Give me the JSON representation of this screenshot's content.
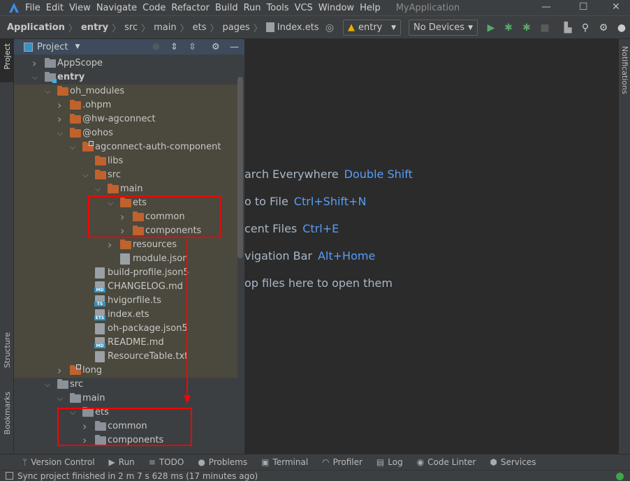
{
  "titlebar": {
    "menus": [
      "File",
      "Edit",
      "View",
      "Navigate",
      "Code",
      "Refactor",
      "Build",
      "Run",
      "Tools",
      "VCS",
      "Window",
      "Help"
    ],
    "app_title": "MyApplication"
  },
  "breadcrumb": [
    "Application",
    "entry",
    "src",
    "main",
    "ets",
    "pages",
    "Index.ets"
  ],
  "toolbar": {
    "module": "entry",
    "device": "No Devices"
  },
  "leftstrip": {
    "project": "Project",
    "structure": "Structure",
    "bookmarks": "Bookmarks"
  },
  "rightstrip": {
    "notifications": "Notifications"
  },
  "panel": {
    "title": "Project"
  },
  "tree": [
    {
      "name": "AppScope",
      "level": 0,
      "kind": "folder",
      "state": "collapsed",
      "color": "gray"
    },
    {
      "name": "entry",
      "level": 0,
      "kind": "module",
      "state": "expanded",
      "color": "gray",
      "bold": true
    },
    {
      "name": "oh_modules",
      "level": 1,
      "kind": "folder",
      "state": "expanded",
      "color": "orange"
    },
    {
      "name": ".ohpm",
      "level": 2,
      "kind": "folder",
      "state": "collapsed",
      "color": "orange"
    },
    {
      "name": "@hw-agconnect",
      "level": 2,
      "kind": "folder",
      "state": "collapsed",
      "color": "orange"
    },
    {
      "name": "@ohos",
      "level": 2,
      "kind": "folder",
      "state": "expanded",
      "color": "orange"
    },
    {
      "name": "agconnect-auth-component",
      "level": 3,
      "kind": "folder",
      "state": "expanded",
      "color": "orange",
      "link": true
    },
    {
      "name": "libs",
      "level": 4,
      "kind": "folder",
      "state": "none",
      "color": "orange"
    },
    {
      "name": "src",
      "level": 4,
      "kind": "folder",
      "state": "expanded",
      "color": "orange"
    },
    {
      "name": "main",
      "level": 5,
      "kind": "folder",
      "state": "expanded",
      "color": "orange"
    },
    {
      "name": "ets",
      "level": 6,
      "kind": "folder",
      "state": "expanded",
      "color": "orange"
    },
    {
      "name": "common",
      "level": 7,
      "kind": "folder",
      "state": "collapsed",
      "color": "orange"
    },
    {
      "name": "components",
      "level": 7,
      "kind": "folder",
      "state": "collapsed",
      "color": "orange"
    },
    {
      "name": "resources",
      "level": 6,
      "kind": "folder",
      "state": "collapsed",
      "color": "orange"
    },
    {
      "name": "module.json",
      "level": 6,
      "kind": "file",
      "tag": "{}"
    },
    {
      "name": "build-profile.json5",
      "level": 4,
      "kind": "file",
      "tag": "{}"
    },
    {
      "name": "CHANGELOG.md",
      "level": 4,
      "kind": "file",
      "tag": "MD"
    },
    {
      "name": "hvigorfile.ts",
      "level": 4,
      "kind": "file",
      "tag": "TS"
    },
    {
      "name": "index.ets",
      "level": 4,
      "kind": "file",
      "tag": "ETS"
    },
    {
      "name": "oh-package.json5",
      "level": 4,
      "kind": "file",
      "tag": "{}"
    },
    {
      "name": "README.md",
      "level": 4,
      "kind": "file",
      "tag": "MD"
    },
    {
      "name": "ResourceTable.txt",
      "level": 4,
      "kind": "file",
      "tag": "TXT"
    },
    {
      "name": "long",
      "level": 2,
      "kind": "folder",
      "state": "collapsed",
      "color": "orange",
      "link": true
    },
    {
      "name": "src",
      "level": 1,
      "kind": "folder",
      "state": "expanded",
      "color": "gray"
    },
    {
      "name": "main",
      "level": 2,
      "kind": "folder",
      "state": "expanded",
      "color": "gray"
    },
    {
      "name": "ets",
      "level": 3,
      "kind": "folder",
      "state": "expanded",
      "color": "gray"
    },
    {
      "name": "common",
      "level": 4,
      "kind": "folder",
      "state": "collapsed",
      "color": "gray"
    },
    {
      "name": "components",
      "level": 4,
      "kind": "folder",
      "state": "collapsed",
      "color": "gray"
    }
  ],
  "editor_hints": [
    {
      "text": "arch Everywhere",
      "key": "Double Shift"
    },
    {
      "text": "o to File",
      "key": "Ctrl+Shift+N"
    },
    {
      "text": "cent Files",
      "key": "Ctrl+E"
    },
    {
      "text": "vigation Bar",
      "key": "Alt+Home"
    },
    {
      "text": "op files here to open them",
      "key": ""
    }
  ],
  "toolwindows": [
    {
      "label": "Version Control",
      "icon": "version-control-icon",
      "glyph": "ᛘ"
    },
    {
      "label": "Run",
      "icon": "run-icon",
      "glyph": "▶"
    },
    {
      "label": "TODO",
      "icon": "todo-icon",
      "glyph": "≡"
    },
    {
      "label": "Problems",
      "icon": "problems-icon",
      "glyph": "●"
    },
    {
      "label": "Terminal",
      "icon": "terminal-icon",
      "glyph": "▣"
    },
    {
      "label": "Profiler",
      "icon": "profiler-icon",
      "glyph": "◠"
    },
    {
      "label": "Log",
      "icon": "log-icon",
      "glyph": "▤"
    },
    {
      "label": "Code Linter",
      "icon": "code-linter-icon",
      "glyph": "◉"
    },
    {
      "label": "Services",
      "icon": "services-icon",
      "glyph": "⬢"
    }
  ],
  "status": {
    "message": "Sync project finished in 2 m 7 s 628 ms (17 minutes ago)"
  },
  "colors": {
    "folder_orange": "#c0622d",
    "folder_gray": "#8a9198",
    "highlight": "#4b483d",
    "accent_link": "#589df6",
    "annotation": "#ff0000",
    "run_green": "#59a869"
  }
}
